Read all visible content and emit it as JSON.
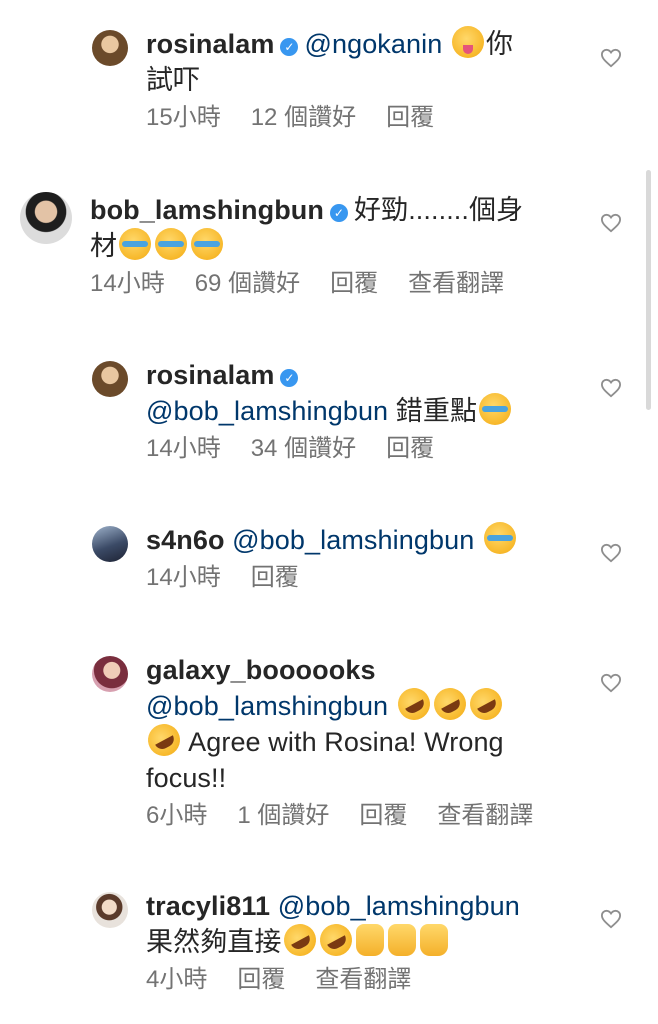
{
  "comments": [
    {
      "user": "rosinalam",
      "verified": true,
      "mention": "@ngokanin",
      "text_after": "你\n試吓",
      "time": "15小時",
      "likes": "12 個讚好",
      "reply": "回覆",
      "translate": "",
      "avatar_color": "#6b4a2a",
      "emoji": [
        "tongue"
      ]
    },
    {
      "user": "bob_lamshingbun",
      "verified": true,
      "mention": "",
      "text_after": "好勁........個身材",
      "time": "14小時",
      "likes": "69 個讚好",
      "reply": "回覆",
      "translate": "查看翻譯",
      "avatar_color": "#9a9a9a",
      "emoji": [
        "tears",
        "tears",
        "tears"
      ]
    },
    {
      "user": "rosinalam",
      "verified": true,
      "mention": "@bob_lamshingbun",
      "text_after": "錯重點",
      "time": "14小時",
      "likes": "34 個讚好",
      "reply": "回覆",
      "translate": "",
      "avatar_color": "#6b4a2a",
      "emoji": [
        "tears"
      ]
    },
    {
      "user": "s4n6o",
      "verified": false,
      "mention": "@bob_lamshingbun",
      "text_after": "",
      "time": "14小時",
      "likes": "",
      "reply": "回覆",
      "translate": "",
      "avatar_color": "#3b4a66",
      "emoji": [
        "tears"
      ]
    },
    {
      "user": "galaxy_boooooks",
      "verified": false,
      "mention": "@bob_lamshingbun",
      "text_after": "Agree with Rosina! Wrong focus!!",
      "time": "6小時",
      "likes": "1 個讚好",
      "reply": "回覆",
      "translate": "查看翻譯",
      "avatar_color": "#b55a6a",
      "emoji": [
        "rofl",
        "rofl",
        "rofl",
        "rofl"
      ]
    },
    {
      "user": "tracyli811",
      "verified": false,
      "mention": "@bob_lamshingbun",
      "text_after": "果然夠直接",
      "time": "4小時",
      "likes": "",
      "reply": "回覆",
      "translate": "查看翻譯",
      "avatar_color": "#c9b7a8",
      "emoji": [
        "rofl",
        "rofl",
        "thumb",
        "thumb",
        "thumb"
      ]
    }
  ]
}
